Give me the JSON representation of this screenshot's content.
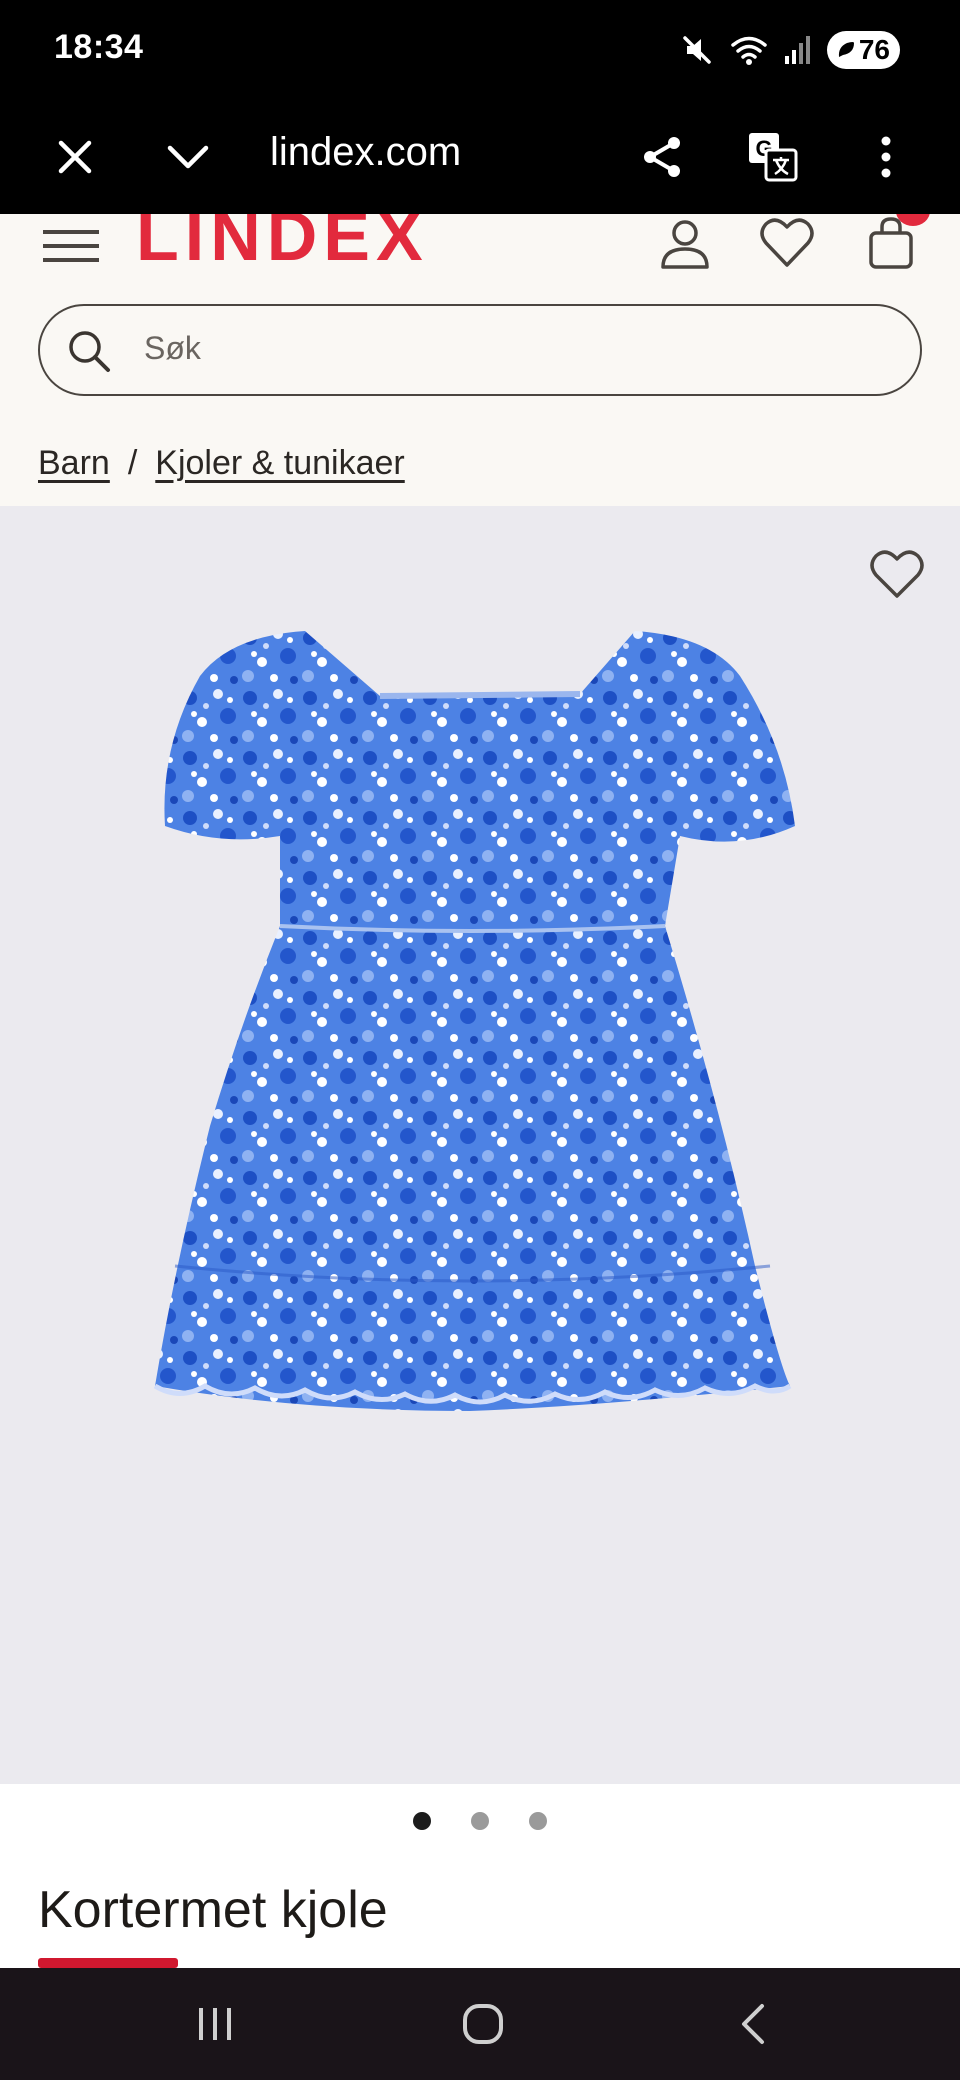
{
  "status_bar": {
    "time": "18:34",
    "battery": "76",
    "icons": [
      "mute-icon",
      "wifi-icon",
      "signal-icon",
      "battery-icon"
    ]
  },
  "browser": {
    "url": "lindex.com",
    "icons": [
      "close-icon",
      "chevron-down-icon",
      "share-icon",
      "translate-icon",
      "more-icon"
    ]
  },
  "site_header": {
    "logo": "LINDEX",
    "search_placeholder": "Søk",
    "icons": [
      "menu-icon",
      "account-icon",
      "wishlist-icon",
      "cart-icon"
    ]
  },
  "breadcrumb": {
    "items": [
      "Barn",
      "Kjoler & tunikaer"
    ],
    "separator": "/"
  },
  "product": {
    "title": "Kortermet kjole",
    "image_count": 3,
    "active_image": 1,
    "dress_color": "#2f63d3"
  },
  "colors": {
    "brand_red": "#e22a3d",
    "header_bg": "#faf8f4",
    "image_bg": "#ebeaef"
  },
  "nav_bar": {
    "icons": [
      "recent-apps-icon",
      "home-icon",
      "back-icon"
    ]
  }
}
